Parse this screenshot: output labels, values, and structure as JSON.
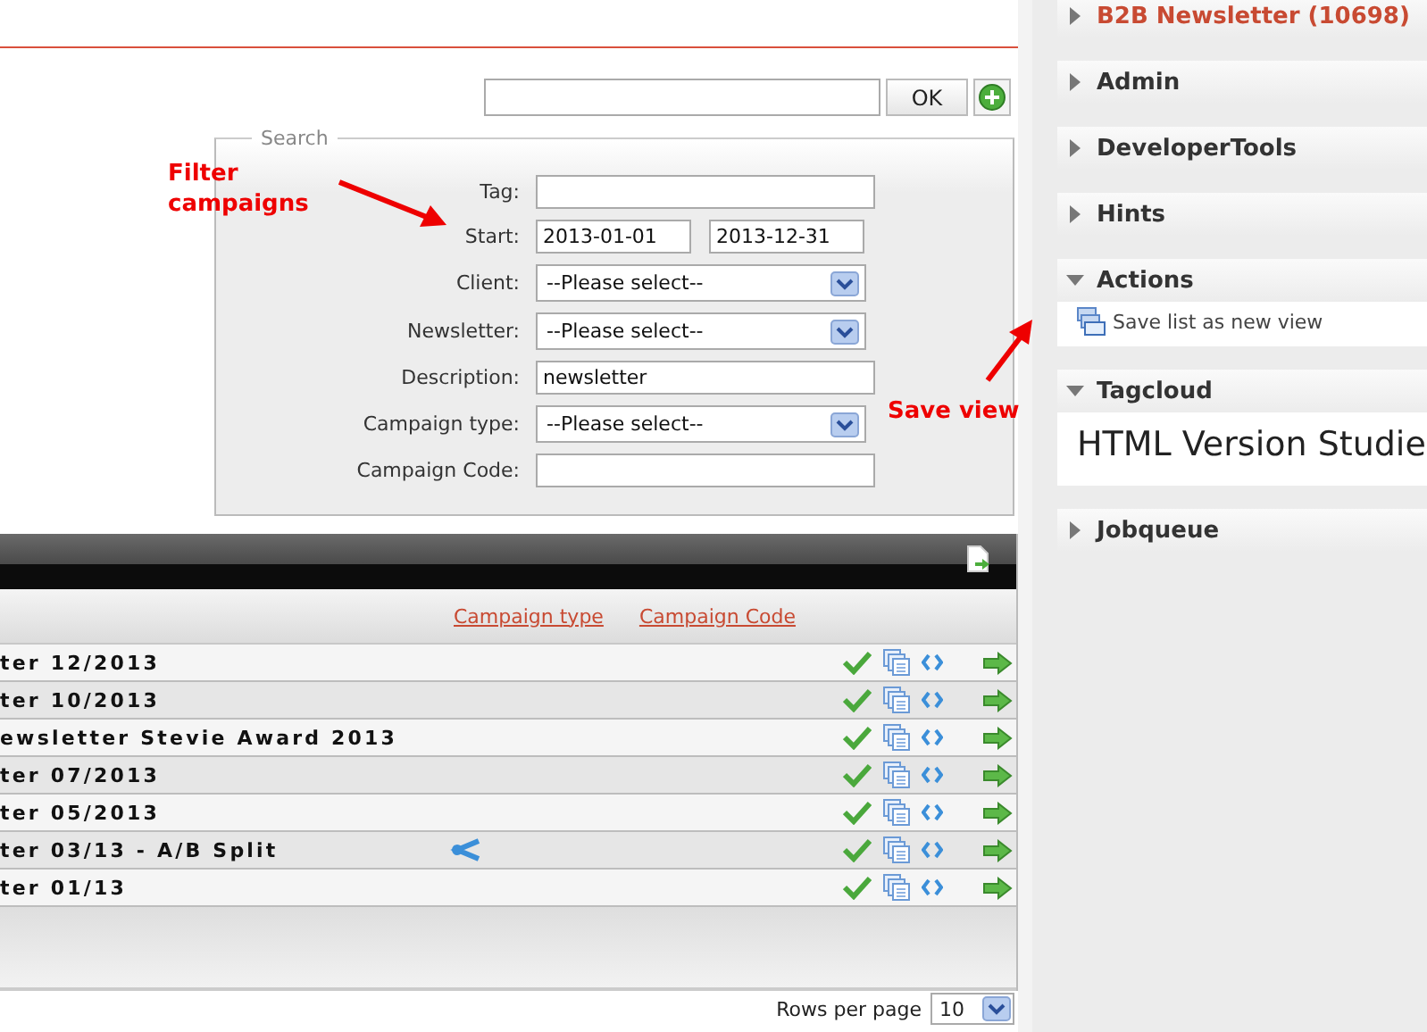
{
  "quick_search": {
    "button": "OK"
  },
  "search": {
    "legend": "Search",
    "fields": [
      {
        "label": "Tag:",
        "kind": "text"
      },
      {
        "label": "Start:",
        "kind": "range",
        "values": [
          "2013-01-01",
          "2013-12-31"
        ]
      },
      {
        "label": "Client:",
        "kind": "select",
        "value": "--Please select--"
      },
      {
        "label": "Newsletter:",
        "kind": "select",
        "value": "--Please select--"
      },
      {
        "label": "Description:",
        "kind": "text",
        "value": "newsletter"
      },
      {
        "label": "Campaign type:",
        "kind": "select",
        "value": "--Please select--"
      },
      {
        "label": "Campaign Code:",
        "kind": "text"
      }
    ]
  },
  "annotations": [
    {
      "text": "Filter campaigns",
      "kind": "filter"
    },
    {
      "text": "Save view",
      "kind": "save"
    }
  ],
  "table": {
    "columns": [
      "Campaign type",
      "Campaign Code"
    ],
    "rows": [
      {
        "name": "ter 12/2013",
        "split": false
      },
      {
        "name": "ter 10/2013",
        "split": false
      },
      {
        "name": "ewsletter Stevie Award 2013",
        "split": false
      },
      {
        "name": "ter 07/2013",
        "split": false
      },
      {
        "name": "ter 05/2013",
        "split": false
      },
      {
        "name": "ter 03/13 - A/B Split",
        "split": true
      },
      {
        "name": "ter 01/13",
        "split": false
      }
    ]
  },
  "pagination": {
    "label": "Rows per page",
    "value": "10"
  },
  "sidebar": [
    {
      "title": "B2B Newsletter (10698)",
      "active": true,
      "expanded": false
    },
    {
      "title": "Admin",
      "active": false,
      "expanded": false
    },
    {
      "title": "DeveloperTools",
      "active": false,
      "expanded": false
    },
    {
      "title": "Hints",
      "active": false,
      "expanded": false
    },
    {
      "title": "Actions",
      "active": false,
      "expanded": true,
      "kind": "actions",
      "items": [
        "Save list as new view"
      ]
    },
    {
      "title": "Tagcloud",
      "active": false,
      "expanded": true,
      "kind": "tags",
      "items": [
        "HTML Version Studie"
      ]
    },
    {
      "title": "Jobqueue",
      "active": false,
      "expanded": false
    }
  ]
}
